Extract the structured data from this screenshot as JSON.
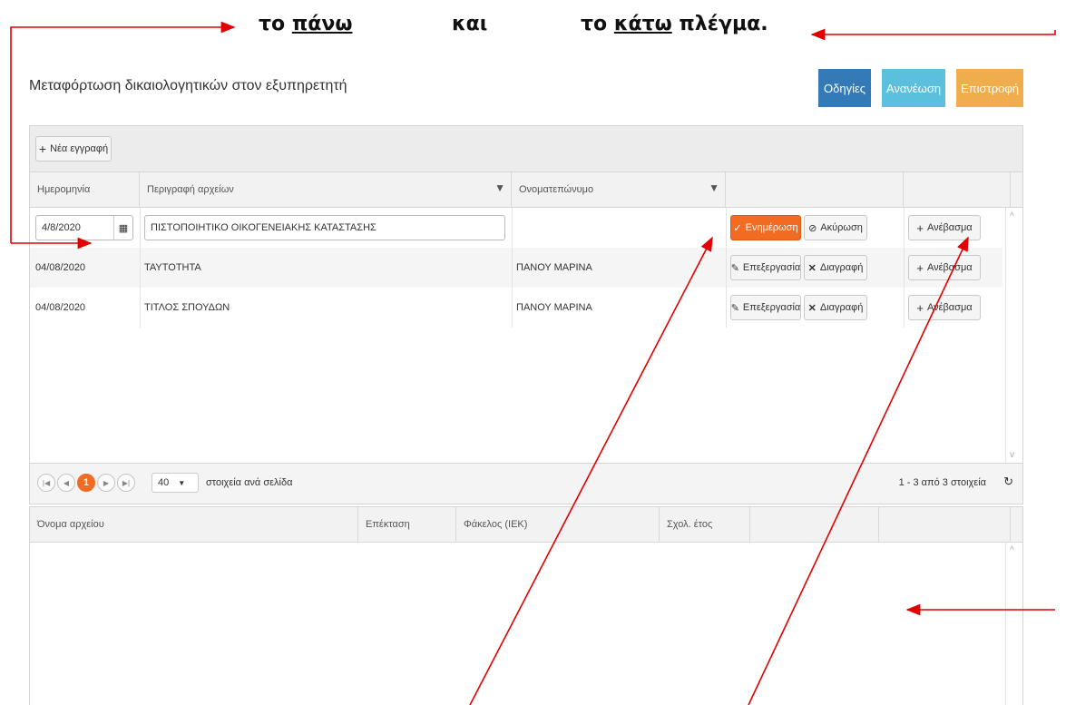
{
  "caption": {
    "prefix1": "το",
    "word1": "πάνω",
    "middle": "και",
    "prefix2": "το",
    "word2": "κάτω",
    "suffix": "πλέγμα."
  },
  "page": {
    "title": "Μεταφόρτωση δικαιολογητικών στον εξυπηρετητή",
    "buttons": {
      "instructions": "Οδηγίες",
      "refresh": "Ανανέωση",
      "back": "Επιστροφή"
    }
  },
  "colors": {
    "instructions": "#337ab7",
    "refresh": "#5bc0de",
    "back": "#f0ad4e",
    "update": "#f26b22",
    "page_active": "#f26b22",
    "annotation": "#e00000"
  },
  "upper_grid": {
    "new_record_label": "Νέα εγγραφή",
    "columns": [
      "Ημερομηνία",
      "Περιγραφή αρχείων",
      "Ονοματεπώνυμο"
    ],
    "edit_row": {
      "date": "4/8/2020",
      "description": "ΠΙΣΤΟΠΟΙΗΤΙΚΟ ΟΙΚΟΓΕΝΕΙΑΚΗΣ ΚΑΤΑΣΤΑΣΗΣ",
      "update_label": "Ενημέρωση",
      "cancel_label": "Ακύρωση",
      "upload_label": "Ανέβασμα"
    },
    "rows": [
      {
        "date": "04/08/2020",
        "description": "ΤΑΥΤΟΤΗΤΑ",
        "name": "ΠΑΝΟΥ ΜΑΡΙΝΑ",
        "edit": "Επεξεργασία",
        "delete": "Διαγραφή",
        "upload": "Ανέβασμα"
      },
      {
        "date": "04/08/2020",
        "description": "ΤΙΤΛΟΣ ΣΠΟΥΔΩΝ",
        "name": "ΠΑΝΟΥ ΜΑΡΙΝΑ",
        "edit": "Επεξεργασία",
        "delete": "Διαγραφή",
        "upload": "Ανέβασμα"
      }
    ],
    "pager": {
      "current_page": "1",
      "page_size": "40",
      "page_size_label": "στοιχεία ανά σελίδα",
      "summary": "1 - 3 από 3 στοιχεία"
    }
  },
  "lower_grid": {
    "columns": [
      "Όνομα αρχείου",
      "Επέκταση",
      "Φάκελος (ΙΕΚ)",
      "Σχολ. έτος"
    ]
  }
}
